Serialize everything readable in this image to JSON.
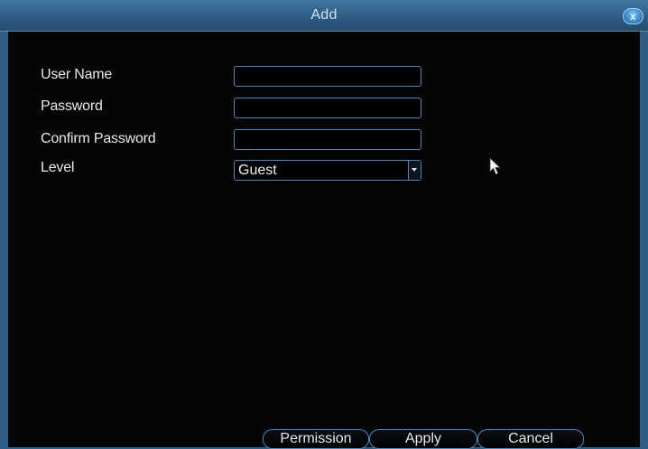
{
  "window": {
    "title": "Add"
  },
  "form": {
    "user_name_label": "User Name",
    "password_label": "Password",
    "confirm_password_label": "Confirm Password",
    "level_label": "Level",
    "user_name_value": "",
    "password_value": "",
    "confirm_password_value": "",
    "level_value": "Guest"
  },
  "buttons": {
    "permission": "Permission",
    "apply": "Apply",
    "cancel": "Cancel"
  },
  "icons": {
    "close": "close-icon",
    "dropdown": "chevron-down-icon",
    "cursor": "mouse-pointer-icon"
  },
  "colors": {
    "titlebar": "#2f5f86",
    "border": "#4e86b8",
    "background": "#050505",
    "text": "#e9e9e9"
  }
}
